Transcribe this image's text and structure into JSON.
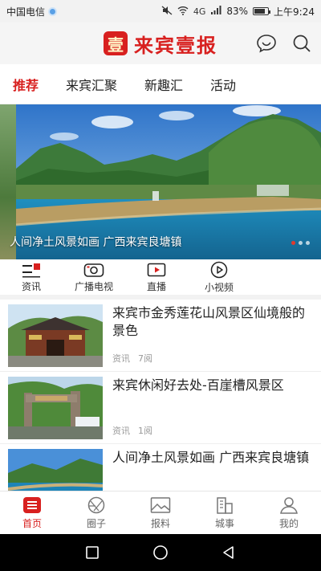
{
  "status_bar": {
    "carrier": "中国电信",
    "network": "4G",
    "battery": "83%",
    "battery_level": 0.83,
    "time": "上午9:24"
  },
  "header": {
    "logo_mark": "壹",
    "title": "来宾壹报",
    "icons": [
      "chat-icon",
      "search-icon"
    ]
  },
  "tabs": [
    {
      "label": "推荐",
      "active": true
    },
    {
      "label": "来宾汇聚",
      "active": false
    },
    {
      "label": "新趣汇",
      "active": false
    },
    {
      "label": "活动",
      "active": false
    }
  ],
  "banner": {
    "caption": "人间净土风景如画 广西来宾良塘镇",
    "slide_count": 3,
    "active_slide": 1
  },
  "channels": [
    {
      "label": "资讯",
      "icon": "news-icon"
    },
    {
      "label": "广播电视",
      "icon": "camera-icon"
    },
    {
      "label": "直播",
      "icon": "live-video-icon"
    },
    {
      "label": "小视频",
      "icon": "play-circle-icon"
    }
  ],
  "news": [
    {
      "title": "来宾市金秀莲花山风景区仙境般的景色",
      "source": "资讯",
      "views": "7阅"
    },
    {
      "title": "来宾休闲好去处-百崖槽风景区",
      "source": "资讯",
      "views": "1阅"
    },
    {
      "title": "人间净土风景如画 广西来宾良塘镇",
      "source": "",
      "views": ""
    }
  ],
  "bottom_nav": [
    {
      "label": "首页",
      "icon": "home-icon",
      "active": true
    },
    {
      "label": "圈子",
      "icon": "circle-icon",
      "active": false
    },
    {
      "label": "报料",
      "icon": "image-icon",
      "active": false
    },
    {
      "label": "城事",
      "icon": "building-icon",
      "active": false
    },
    {
      "label": "我的",
      "icon": "user-icon",
      "active": false
    }
  ],
  "colors": {
    "accent": "#d8201f",
    "text": "#222222",
    "muted": "#999999"
  }
}
